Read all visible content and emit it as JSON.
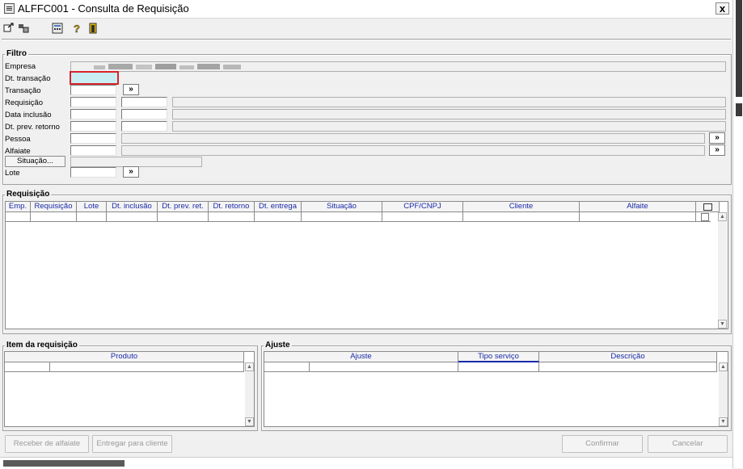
{
  "window": {
    "title": "ALFFC001 - Consulta de Requisição",
    "close_label": "x"
  },
  "toolbar": {
    "icons": [
      "export-icon",
      "layout-icon",
      "calculator-icon",
      "help-icon",
      "exit-icon"
    ]
  },
  "filtro": {
    "title": "Filtro",
    "labels": {
      "empresa": "Empresa",
      "dt_transacao": "Dt. transação",
      "transacao": "Transação",
      "requisicao": "Requisição",
      "data_inclusao": "Data inclusão",
      "dt_prev_retorno": "Dt. prev. retorno",
      "pessoa": "Pessoa",
      "alfaiate": "Alfaiate",
      "lote": "Lote"
    },
    "situacao_button": "Situação...",
    "pick_label": "»"
  },
  "requisicao": {
    "title": "Requisição",
    "columns": [
      "Emp.",
      "Requisição",
      "Lote",
      "Dt. inclusão",
      "Dt. prev. ret.",
      "Dt. retorno",
      "Dt. entrega",
      "Situação",
      "CPF/CNPJ",
      "Cliente",
      "Alfaite"
    ]
  },
  "item_requisicao": {
    "title": "Item da requisição",
    "columns": [
      "Produto"
    ]
  },
  "ajuste": {
    "title": "Ajuste",
    "columns": [
      "Ajuste",
      "Tipo serviço",
      "Descrição"
    ]
  },
  "buttons": {
    "receber": "Receber de alfaiate",
    "entregar": "Entregar para cliente",
    "confirmar": "Confirmar",
    "cancelar": "Cancelar"
  },
  "colors": {
    "active_field": "#c8eef4",
    "focus_outline": "#d8232a",
    "header_text": "#1a2aa8"
  }
}
